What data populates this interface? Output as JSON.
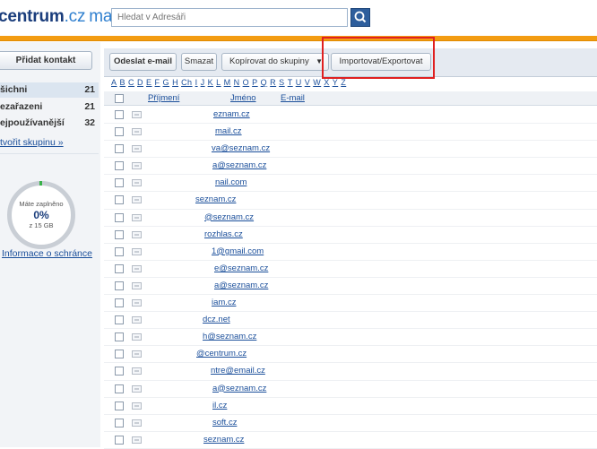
{
  "header": {
    "logo_brand": "centrum",
    "logo_tld": ".cz",
    "logo_product": "mail",
    "search_placeholder": "Hledat v Adresáři"
  },
  "sidebar": {
    "add_contact": "Přidat kontakt",
    "groups": [
      {
        "label": "šichni",
        "count": "21"
      },
      {
        "label": "ezařazeni",
        "count": "21"
      },
      {
        "label": "ejpoužívanější",
        "count": "32"
      }
    ],
    "create_group": "tvořit skupinu »",
    "quota": {
      "label": "Máte zaplněno",
      "value": "0%",
      "total": "z 15 GB"
    },
    "mailbox_info": "Informace o schránce"
  },
  "toolbar": {
    "send": "Odeslat e-mail",
    "delete": "Smazat",
    "copy": "Kopírovat do skupiny",
    "import_export": "Importovat/Exportovat"
  },
  "alphabet": [
    "A",
    "B",
    "C",
    "D",
    "E",
    "F",
    "G",
    "H",
    "Ch",
    "I",
    "J",
    "K",
    "L",
    "M",
    "N",
    "O",
    "P",
    "Q",
    "R",
    "S",
    "T",
    "U",
    "V",
    "W",
    "X",
    "Y",
    "Z"
  ],
  "table": {
    "headers": {
      "surname": "Příjmení",
      "name": "Jméno",
      "email": "E-mail"
    },
    "rows": [
      {
        "email": "eznam.cz"
      },
      {
        "email": "mail.cz"
      },
      {
        "email": "va@seznam.cz"
      },
      {
        "email": "a@seznam.cz"
      },
      {
        "email": "nail.com"
      },
      {
        "email": "seznam.cz"
      },
      {
        "email": "@seznam.cz"
      },
      {
        "email": "rozhlas.cz"
      },
      {
        "email": "1@gmail.com"
      },
      {
        "email": "e@seznam.cz"
      },
      {
        "email": "a@seznam.cz"
      },
      {
        "email": "iam.cz"
      },
      {
        "email": "dcz.net"
      },
      {
        "email": "h@seznam.cz"
      },
      {
        "email": "@centrum.cz"
      },
      {
        "email": "ntre@email.cz"
      },
      {
        "email": "a@seznam.cz"
      },
      {
        "email": "il.cz"
      },
      {
        "email": "soft.cz"
      },
      {
        "email": "seznam.cz"
      }
    ]
  }
}
